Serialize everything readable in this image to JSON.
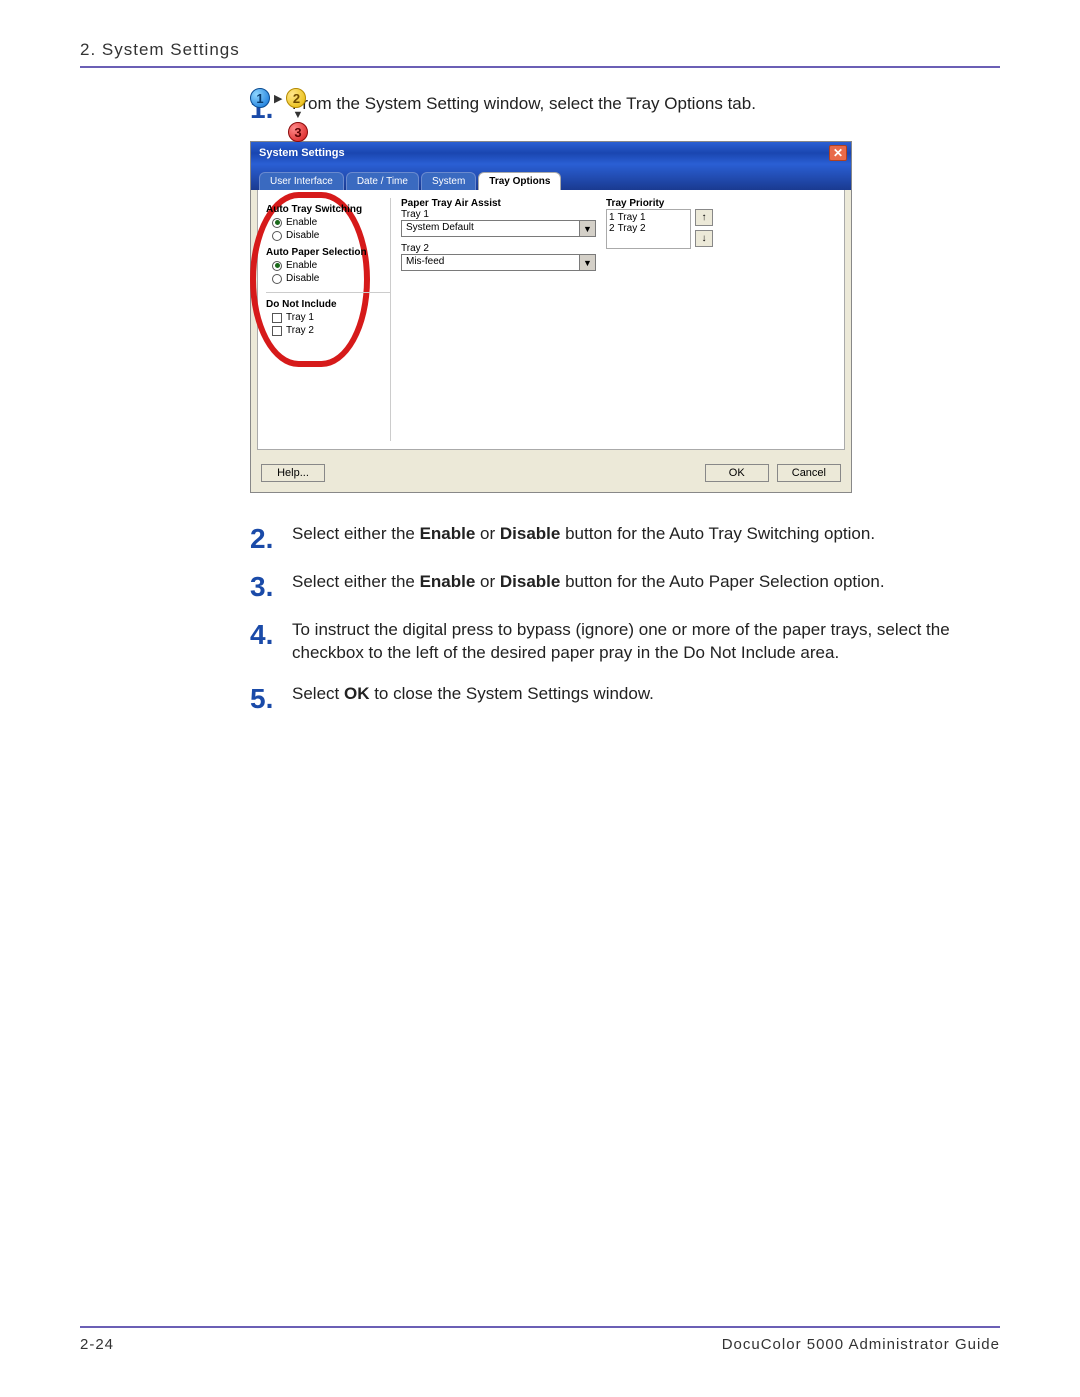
{
  "header": {
    "title": "2. System Settings"
  },
  "steps": {
    "s1": {
      "num": "1.",
      "text": "From the System Setting window, select the Tray Options tab."
    },
    "s2": {
      "num": "2.",
      "prefix": "Select either the ",
      "b1": "Enable",
      "mid": " or ",
      "b2": "Disable",
      "suffix": " button for the Auto Tray Switching option."
    },
    "s3": {
      "num": "3.",
      "prefix": "Select either the ",
      "b1": "Enable",
      "mid": " or ",
      "b2": "Disable",
      "suffix": " button for the Auto Paper Selection option."
    },
    "s4": {
      "num": "4.",
      "text": "To instruct the digital press to bypass (ignore) one or more of the paper trays, select the checkbox to the left of the desired paper pray in the Do Not Include area."
    },
    "s5": {
      "num": "5.",
      "prefix": "Select ",
      "b1": "OK",
      "suffix": " to close the System Settings window."
    }
  },
  "dialog": {
    "title": "System Settings",
    "tabs": {
      "t1": "User Interface",
      "t2": "Date / Time",
      "t3": "System",
      "t4": "Tray Options"
    },
    "col1": {
      "autoTraySwitching": "Auto Tray Switching",
      "enable": "Enable",
      "disable": "Disable",
      "autoPaperSelection": "Auto Paper Selection",
      "doNotInclude": "Do Not Include",
      "tray1": "Tray 1",
      "tray2": "Tray 2"
    },
    "col2": {
      "header": "Paper Tray Air Assist",
      "tray1": "Tray 1",
      "tray1val": "System Default",
      "tray2": "Tray 2",
      "tray2val": "Mis-feed"
    },
    "col3": {
      "header": "Tray Priority",
      "r1n": "1",
      "r1t": "Tray 1",
      "r2n": "2",
      "r2t": "Tray 2"
    },
    "buttons": {
      "help": "Help...",
      "ok": "OK",
      "cancel": "Cancel"
    }
  },
  "footer": {
    "page": "2-24",
    "guide": "DocuColor 5000 Administrator Guide"
  },
  "badges": {
    "b1": "1",
    "b2": "2",
    "b3": "3"
  }
}
